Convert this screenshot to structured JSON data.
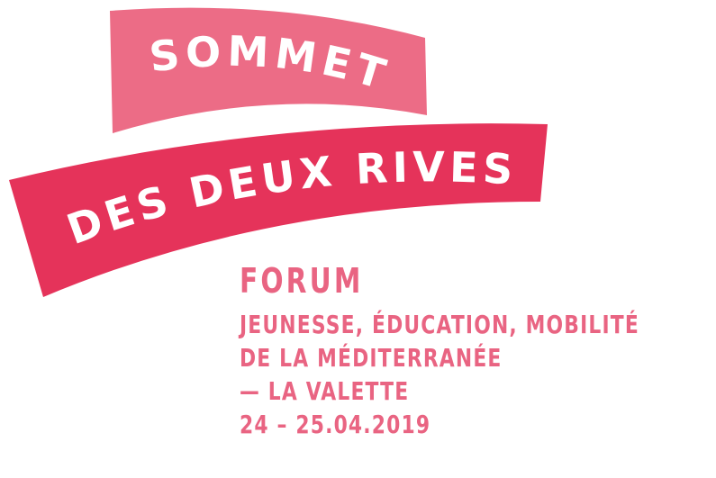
{
  "logo": {
    "top_banner_text": "SOMMET",
    "bottom_banner_text": "DES DEUX RIVES"
  },
  "event": {
    "title": "FORUM",
    "lines": [
      "JEUNESSE, ÉDUCATION, MOBILITÉ",
      "DE LA MÉDITERRANÉE",
      "— LA VALETTE",
      "24 – 25.04.2019"
    ]
  },
  "colors": {
    "top_banner": "#ec6c86",
    "bottom_banner": "#e5335a",
    "text_accent": "#e96482",
    "banner_text": "#ffffff"
  }
}
